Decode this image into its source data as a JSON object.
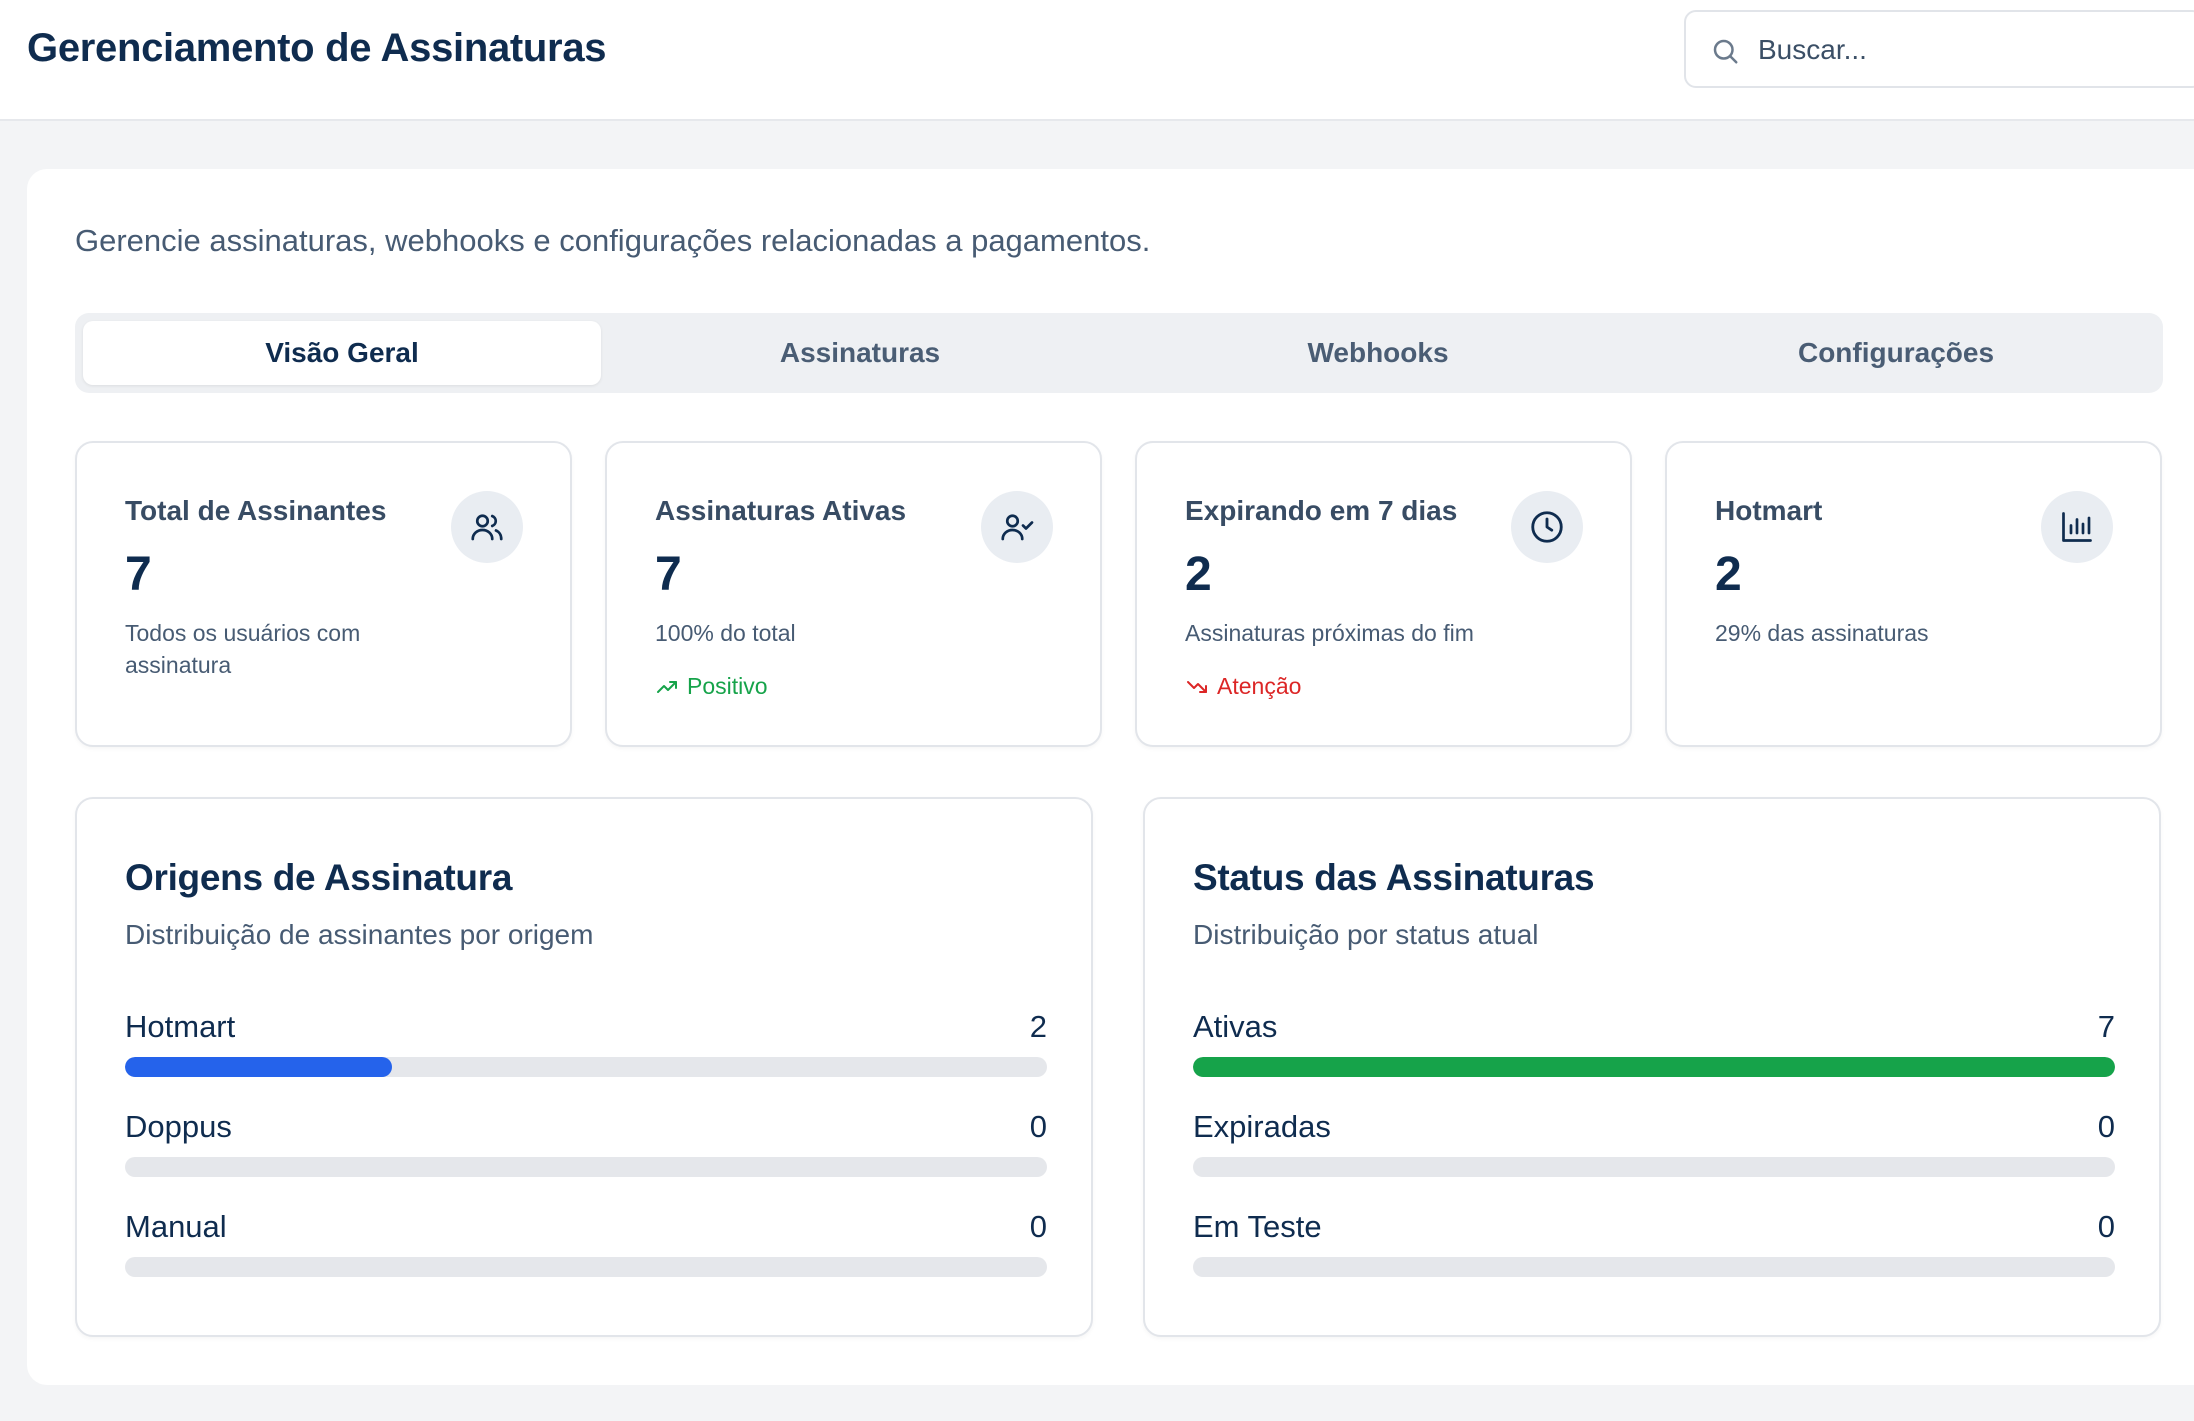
{
  "header": {
    "title": "Gerenciamento de Assinaturas",
    "search_placeholder": "Buscar..."
  },
  "page": {
    "subtitle": "Gerencie assinaturas, webhooks e configurações relacionadas a pagamentos."
  },
  "tabs": [
    {
      "label": "Visão Geral",
      "active": true
    },
    {
      "label": "Assinaturas",
      "active": false
    },
    {
      "label": "Webhooks",
      "active": false
    },
    {
      "label": "Configurações",
      "active": false
    }
  ],
  "stats": [
    {
      "title": "Total de Assinantes",
      "value": "7",
      "description": "Todos os usuários com assinatura",
      "icon": "users-icon"
    },
    {
      "title": "Assinaturas Ativas",
      "value": "7",
      "description": "100% do total",
      "trend": "Positivo",
      "trend_type": "positive",
      "icon": "user-check-icon"
    },
    {
      "title": "Expirando em 7 dias",
      "value": "2",
      "description": "Assinaturas próximas do fim",
      "trend": "Atenção",
      "trend_type": "negative",
      "icon": "clock-icon"
    },
    {
      "title": "Hotmart",
      "value": "2",
      "description": "29% das assinaturas",
      "icon": "bar-chart-icon"
    }
  ],
  "origins": {
    "title": "Origens de Assinatura",
    "subtitle": "Distribuição de assinantes por origem",
    "color": "#2563eb",
    "items": [
      {
        "label": "Hotmart",
        "value": "2",
        "fraction": 0.29
      },
      {
        "label": "Doppus",
        "value": "0",
        "fraction": 0
      },
      {
        "label": "Manual",
        "value": "0",
        "fraction": 0
      }
    ]
  },
  "status": {
    "title": "Status das Assinaturas",
    "subtitle": "Distribuição por status atual",
    "color": "#16a34a",
    "items": [
      {
        "label": "Ativas",
        "value": "7",
        "fraction": 1.0
      },
      {
        "label": "Expiradas",
        "value": "0",
        "fraction": 0
      },
      {
        "label": "Em Teste",
        "value": "0",
        "fraction": 0
      }
    ]
  }
}
